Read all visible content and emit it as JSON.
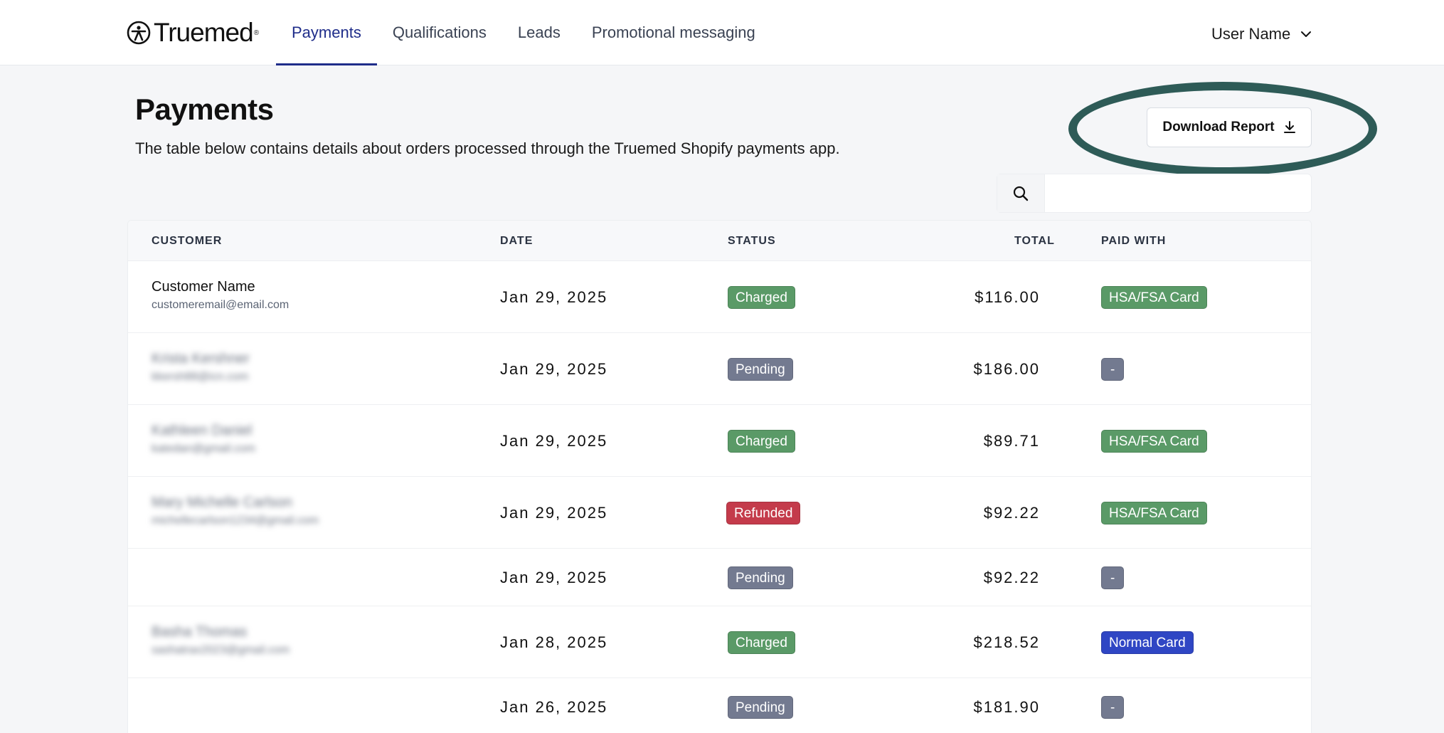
{
  "brand": {
    "name": "Truemed"
  },
  "nav": {
    "tabs": [
      {
        "label": "Payments",
        "active": true
      },
      {
        "label": "Qualifications",
        "active": false
      },
      {
        "label": "Leads",
        "active": false
      },
      {
        "label": "Promotional messaging",
        "active": false
      }
    ],
    "user_name": "User Name"
  },
  "page": {
    "title": "Payments",
    "description": "The table below contains details about orders processed through the Truemed Shopify payments app.",
    "download_label": "Download Report"
  },
  "search": {
    "placeholder": ""
  },
  "table": {
    "columns": [
      "CUSTOMER",
      "DATE",
      "STATUS",
      "TOTAL",
      "PAID WITH"
    ],
    "rows": [
      {
        "name": "Customer Name",
        "email": "customeremail@email.com",
        "blurred": false,
        "date": "Jan 29, 2025",
        "status": "Charged",
        "status_type": "charged",
        "total": "$116.00",
        "paid_with": "HSA/FSA Card",
        "paid_type": "hsa"
      },
      {
        "name": "Krista Kershner",
        "email": "kkersh88@icn.com",
        "blurred": true,
        "date": "Jan 29, 2025",
        "status": "Pending",
        "status_type": "pending",
        "total": "$186.00",
        "paid_with": "-",
        "paid_type": "dash"
      },
      {
        "name": "Kathleen Daniel",
        "email": "katedan@gmail.com",
        "blurred": true,
        "date": "Jan 29, 2025",
        "status": "Charged",
        "status_type": "charged",
        "total": "$89.71",
        "paid_with": "HSA/FSA Card",
        "paid_type": "hsa"
      },
      {
        "name": "Mary Michelle Carlson",
        "email": "michellecarlson1234@gmail.com",
        "blurred": true,
        "date": "Jan 29, 2025",
        "status": "Refunded",
        "status_type": "refunded",
        "total": "$92.22",
        "paid_with": "HSA/FSA Card",
        "paid_type": "hsa"
      },
      {
        "name": "",
        "email": "",
        "blurred": false,
        "date": "Jan 29, 2025",
        "status": "Pending",
        "status_type": "pending",
        "total": "$92.22",
        "paid_with": "-",
        "paid_type": "dash"
      },
      {
        "name": "Basha Thomas",
        "email": "sashatrax2023@gmail.com",
        "blurred": true,
        "date": "Jan 28, 2025",
        "status": "Charged",
        "status_type": "charged",
        "total": "$218.52",
        "paid_with": "Normal Card",
        "paid_type": "normal"
      },
      {
        "name": "",
        "email": "",
        "blurred": false,
        "date": "Jan 26, 2025",
        "status": "Pending",
        "status_type": "pending",
        "total": "$181.90",
        "paid_with": "-",
        "paid_type": "dash"
      }
    ]
  },
  "colors": {
    "accent": "#1f2d8a",
    "highlight_ring": "#2e5b57",
    "charged": "#5a9a67",
    "pending": "#737a90",
    "refunded": "#c43b4b",
    "normal_card": "#2f46c4"
  }
}
